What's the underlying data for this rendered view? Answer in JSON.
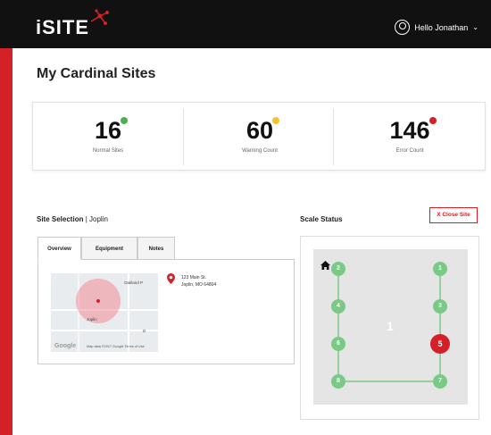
{
  "app": {
    "brand": "iSITE"
  },
  "header": {
    "greeting": "Hello Jonathan"
  },
  "page": {
    "title": "My Cardinal Sites"
  },
  "stats": [
    {
      "value": "16",
      "label": "Normal Sites",
      "color": "#4caf50"
    },
    {
      "value": "60",
      "label": "Warning Count",
      "color": "#f4c430"
    },
    {
      "value": "146",
      "label": "Error Count",
      "color": "#d42027"
    }
  ],
  "site_selection": {
    "label": "Site Selection",
    "site": "Joplin"
  },
  "tabs": [
    "Overview",
    "Equipment",
    "Notes"
  ],
  "map": {
    "place_label": "Joplin",
    "nearby": "Oakland P",
    "google": "Google",
    "credit": "Map data ©2017 Google   Terms of Use",
    "letter": "D"
  },
  "address": {
    "line1": "123 Main St.",
    "line2": "Joplin, MO 64804"
  },
  "scale": {
    "title": "Scale Status",
    "close_label": "X Close Site",
    "zone": "1"
  },
  "nodes": [
    {
      "label": "2",
      "status": "normal"
    },
    {
      "label": "1",
      "status": "normal"
    },
    {
      "label": "4",
      "status": "normal"
    },
    {
      "label": "3",
      "status": "normal"
    },
    {
      "label": "6",
      "status": "normal"
    },
    {
      "label": "5",
      "status": "error"
    },
    {
      "label": "8",
      "status": "normal"
    },
    {
      "label": "7",
      "status": "normal"
    }
  ],
  "colors": {
    "accent": "#d42027",
    "ok": "#7bc986",
    "header": "#111111"
  }
}
